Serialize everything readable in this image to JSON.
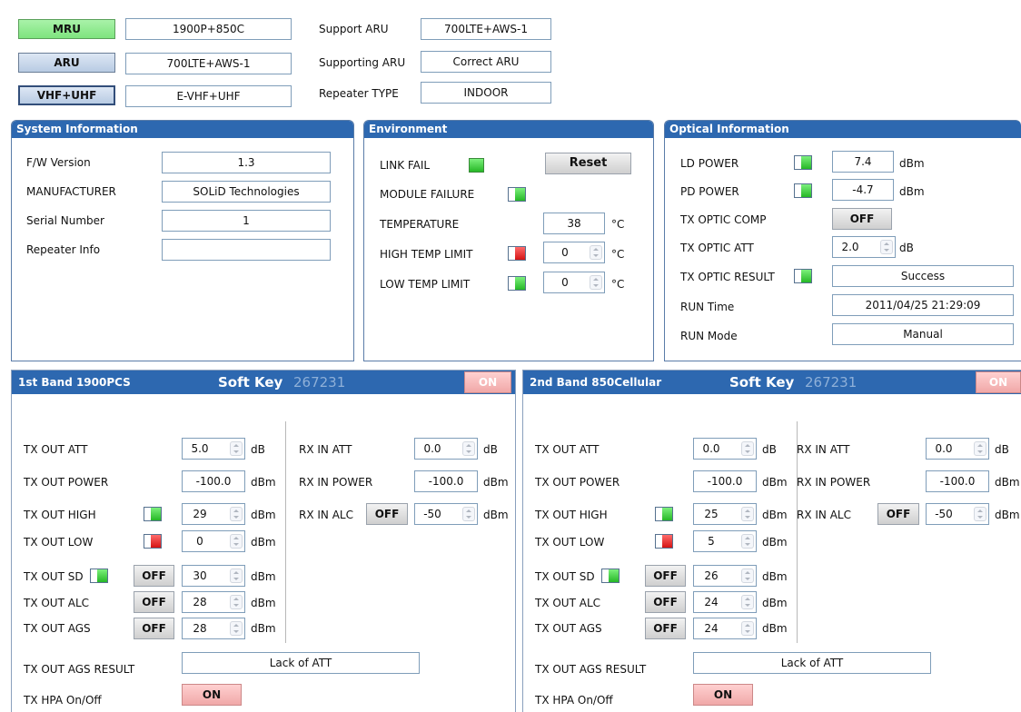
{
  "top": {
    "mru_label": "MRU",
    "mru_value": "1900P+850C",
    "aru_label": "ARU",
    "aru_value": "700LTE+AWS-1",
    "vhf_label": "VHF+UHF",
    "vhf_value": "E-VHF+UHF",
    "support_aru_label": "Support ARU",
    "support_aru_value": "700LTE+AWS-1",
    "supporting_aru_label": "Supporting ARU",
    "supporting_aru_value": "Correct ARU",
    "repeater_type_label": "Repeater TYPE",
    "repeater_type_value": "INDOOR"
  },
  "system": {
    "title": "System Information",
    "fw_label": "F/W Version",
    "fw_value": "1.3",
    "manufacturer_label": "MANUFACTURER",
    "manufacturer_value": "SOLiD Technologies",
    "serial_label": "Serial Number",
    "serial_value": "1",
    "repeater_info_label": "Repeater Info",
    "repeater_info_value": ""
  },
  "environment": {
    "title": "Environment",
    "link_fail_label": "LINK FAIL",
    "reset_label": "Reset",
    "module_failure_label": "MODULE FAILURE",
    "temperature_label": "TEMPERATURE",
    "temperature_value": "38",
    "temperature_unit": "°C",
    "high_temp_label": "HIGH TEMP LIMIT",
    "high_temp_value": "0",
    "high_temp_unit": "°C",
    "low_temp_label": "LOW TEMP LIMIT",
    "low_temp_value": "0",
    "low_temp_unit": "°C"
  },
  "optical": {
    "title": "Optical Information",
    "ld_power_label": "LD POWER",
    "ld_power_value": "7.4",
    "ld_power_unit": "dBm",
    "pd_power_label": "PD POWER",
    "pd_power_value": "-4.7",
    "pd_power_unit": "dBm",
    "tx_optic_comp_label": "TX OPTIC COMP",
    "tx_optic_comp_value": "OFF",
    "tx_optic_att_label": "TX OPTIC ATT",
    "tx_optic_att_value": "2.0",
    "tx_optic_att_unit": "dB",
    "tx_optic_result_label": "TX OPTIC RESULT",
    "tx_optic_result_value": "Success",
    "run_time_label": "RUN Time",
    "run_time_value": "2011/04/25 21:29:09",
    "run_mode_label": "RUN Mode",
    "run_mode_value": "Manual"
  },
  "bands": [
    {
      "title": "1st Band 1900PCS",
      "soft_key_label": "Soft Key",
      "soft_key_value": "267231",
      "on_label": "ON",
      "tx_out_att_label": "TX OUT ATT",
      "tx_out_att_value": "5.0",
      "tx_out_att_unit": "dB",
      "tx_out_power_label": "TX OUT POWER",
      "tx_out_power_value": "-100.0",
      "tx_out_power_unit": "dBm",
      "tx_out_high_label": "TX OUT HIGH",
      "tx_out_high_value": "29",
      "tx_out_high_unit": "dBm",
      "tx_out_low_label": "TX OUT LOW",
      "tx_out_low_value": "0",
      "tx_out_low_unit": "dBm",
      "tx_out_sd_label": "TX OUT SD",
      "tx_out_sd_btn": "OFF",
      "tx_out_sd_value": "30",
      "tx_out_sd_unit": "dBm",
      "tx_out_alc_label": "TX OUT ALC",
      "tx_out_alc_btn": "OFF",
      "tx_out_alc_value": "28",
      "tx_out_alc_unit": "dBm",
      "tx_out_ags_label": "TX OUT AGS",
      "tx_out_ags_btn": "OFF",
      "tx_out_ags_value": "28",
      "tx_out_ags_unit": "dBm",
      "rx_in_att_label": "RX IN ATT",
      "rx_in_att_value": "0.0",
      "rx_in_att_unit": "dB",
      "rx_in_power_label": "RX IN POWER",
      "rx_in_power_value": "-100.0",
      "rx_in_power_unit": "dBm",
      "rx_in_alc_label": "RX IN ALC",
      "rx_in_alc_btn": "OFF",
      "rx_in_alc_value": "-50",
      "rx_in_alc_unit": "dBm",
      "ags_result_label": "TX OUT AGS RESULT",
      "ags_result_value": "Lack of ATT",
      "hpa_label": "TX HPA On/Off",
      "hpa_btn": "ON"
    },
    {
      "title": "2nd Band 850Cellular",
      "soft_key_label": "Soft Key",
      "soft_key_value": "267231",
      "on_label": "ON",
      "tx_out_att_label": "TX OUT ATT",
      "tx_out_att_value": "0.0",
      "tx_out_att_unit": "dB",
      "tx_out_power_label": "TX OUT POWER",
      "tx_out_power_value": "-100.0",
      "tx_out_power_unit": "dBm",
      "tx_out_high_label": "TX OUT HIGH",
      "tx_out_high_value": "25",
      "tx_out_high_unit": "dBm",
      "tx_out_low_label": "TX OUT LOW",
      "tx_out_low_value": "5",
      "tx_out_low_unit": "dBm",
      "tx_out_sd_label": "TX OUT SD",
      "tx_out_sd_btn": "OFF",
      "tx_out_sd_value": "26",
      "tx_out_sd_unit": "dBm",
      "tx_out_alc_label": "TX OUT ALC",
      "tx_out_alc_btn": "OFF",
      "tx_out_alc_value": "24",
      "tx_out_alc_unit": "dBm",
      "tx_out_ags_label": "TX OUT AGS",
      "tx_out_ags_btn": "OFF",
      "tx_out_ags_value": "24",
      "tx_out_ags_unit": "dBm",
      "rx_in_att_label": "RX IN ATT",
      "rx_in_att_value": "0.0",
      "rx_in_att_unit": "dB",
      "rx_in_power_label": "RX IN POWER",
      "rx_in_power_value": "-100.0",
      "rx_in_power_unit": "dBm",
      "rx_in_alc_label": "RX IN ALC",
      "rx_in_alc_btn": "OFF",
      "rx_in_alc_value": "-50",
      "rx_in_alc_unit": "dBm",
      "ags_result_label": "TX OUT AGS RESULT",
      "ags_result_value": "Lack of ATT",
      "hpa_label": "TX HPA On/Off",
      "hpa_btn": "ON"
    }
  ],
  "colors": {
    "panel_header": "#2d68b0",
    "led_green": "#26b826",
    "led_red": "#d41414",
    "on_button": "#f0a8a8"
  }
}
